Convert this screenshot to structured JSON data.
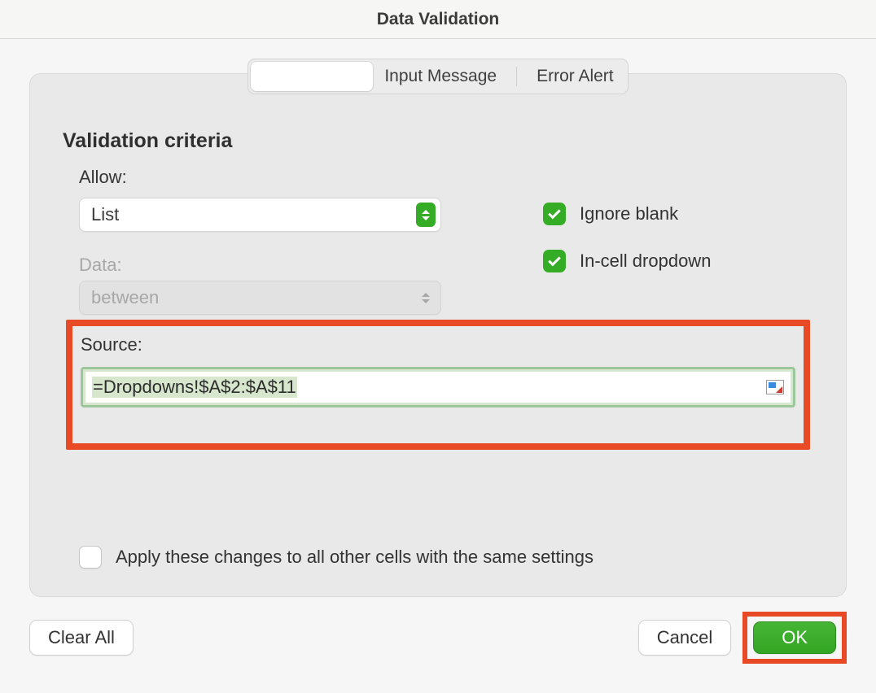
{
  "title": "Data Validation",
  "tabs": {
    "input_message": "Input Message",
    "error_alert": "Error Alert"
  },
  "criteria": {
    "section_title": "Validation criteria",
    "allow_label": "Allow:",
    "allow_value": "List",
    "data_label": "Data:",
    "data_value": "between",
    "ignore_blank_label": "Ignore blank",
    "ignore_blank_checked": true,
    "incell_dropdown_label": "In-cell dropdown",
    "incell_dropdown_checked": true,
    "source_label": "Source:",
    "source_value": "=Dropdowns!$A$2:$A$11"
  },
  "apply_changes_label": "Apply these changes to all other cells with the same settings",
  "apply_changes_checked": false,
  "buttons": {
    "clear_all": "Clear All",
    "cancel": "Cancel",
    "ok": "OK"
  },
  "colors": {
    "accent_green": "#35ac26",
    "highlight_red": "#e74a25"
  }
}
